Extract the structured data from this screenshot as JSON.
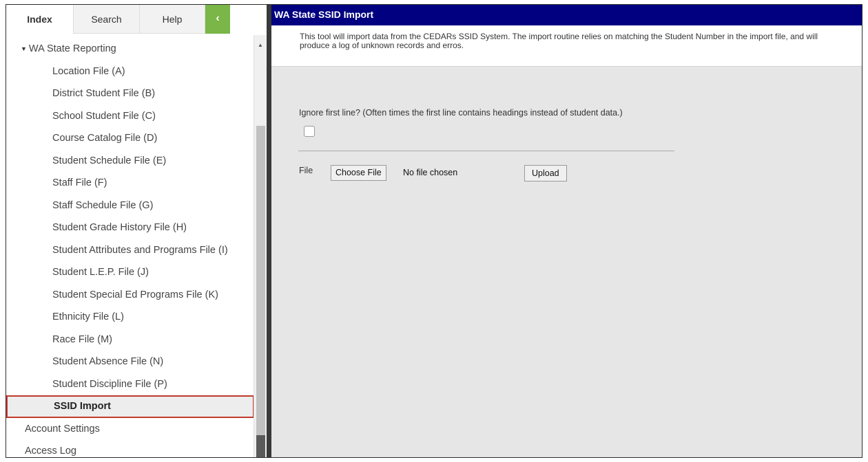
{
  "tabs": {
    "index": "Index",
    "search": "Search",
    "help": "Help",
    "collapse_glyph": "‹"
  },
  "tree": {
    "folder": "WA State Reporting",
    "children": [
      "Location File (A)",
      "District Student File (B)",
      "School Student File (C)",
      "Course Catalog File (D)",
      "Student Schedule File (E)",
      "Staff File (F)",
      "Staff Schedule File (G)",
      "Student Grade History File (H)",
      "Student Attributes and Programs File (I)",
      "Student L.E.P. File (J)",
      "Student Special Ed Programs File (K)",
      "Ethnicity File (L)",
      "Race File (M)",
      "Student Absence File (N)",
      "Student Discipline File (P)"
    ],
    "selected": "SSID Import",
    "root_items": [
      "Account Settings",
      "Access Log"
    ]
  },
  "main": {
    "title": "WA State SSID Import",
    "description": "This tool will import data from the CEDARs SSID System. The import routine relies on matching the Student Number in the import file, and will produce a log of unknown records and erros.",
    "ignore_label": "Ignore first line? (Often times the first line contains headings instead of student data.)",
    "file_label": "File",
    "choose_file": "Choose File",
    "no_file": "No file chosen",
    "upload": "Upload"
  },
  "colors": {
    "header_bg": "#000080",
    "collapse_bg": "#7ab648",
    "selected_outline": "#c0392b"
  }
}
